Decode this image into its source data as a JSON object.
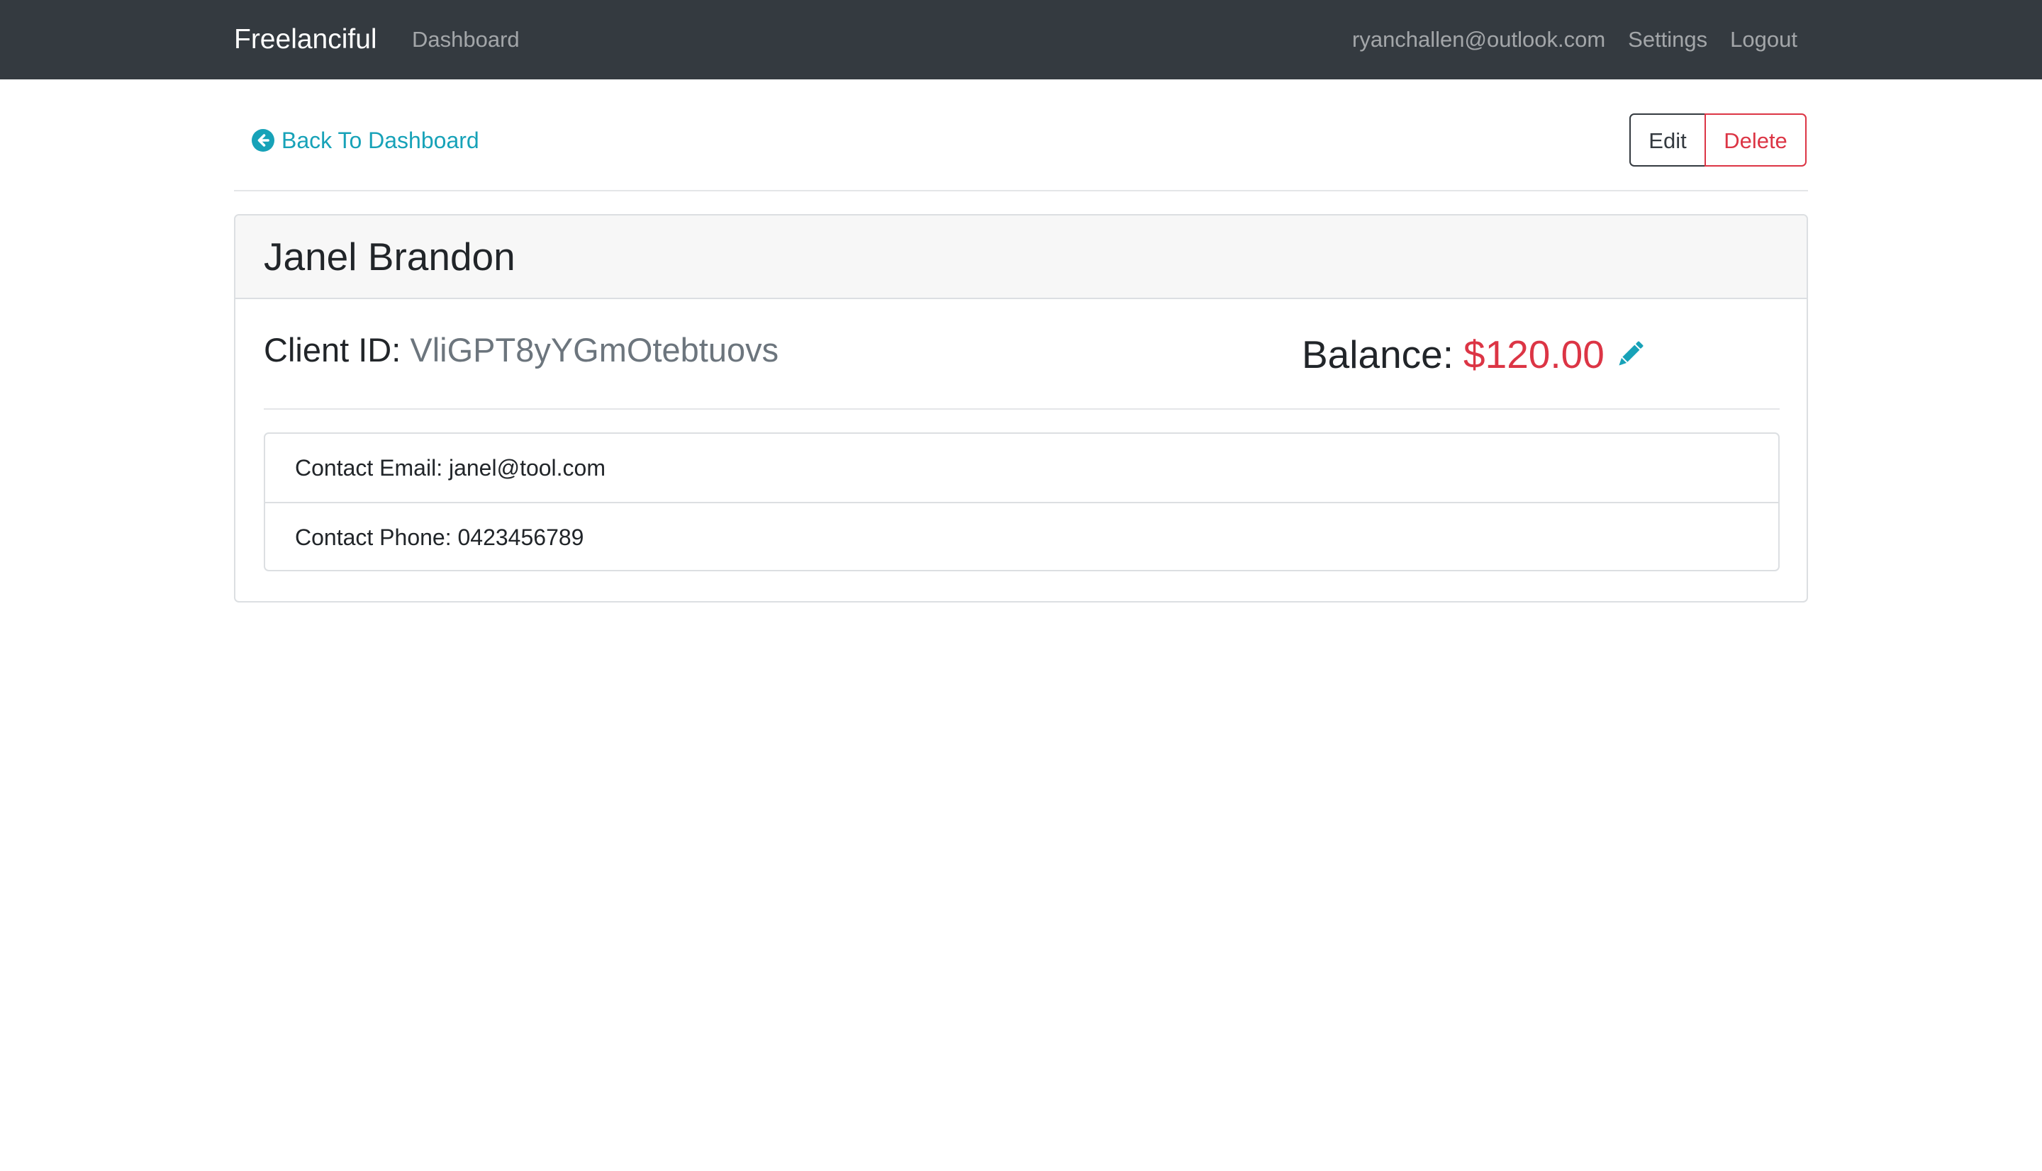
{
  "navbar": {
    "brand": "Freelanciful",
    "dashboard": "Dashboard",
    "user_email": "ryanchallen@outlook.com",
    "settings": "Settings",
    "logout": "Logout"
  },
  "actions": {
    "back_label": "Back To Dashboard",
    "back_icon": "arrow-circle-left-icon",
    "edit_label": "Edit",
    "delete_label": "Delete"
  },
  "client": {
    "name": "Janel Brandon",
    "id_label": "Client ID:",
    "id_value": "VliGPT8yYGmOtebtuovs",
    "balance_label": "Balance:",
    "balance_value": "$120.00",
    "edit_balance_icon": "pencil-icon",
    "contact_email": "Contact Email: janel@tool.com",
    "contact_phone": "Contact Phone: 0423456789"
  },
  "colors": {
    "navbar_bg": "#343a40",
    "accent": "#17a2b8",
    "danger": "#dc3545",
    "muted": "#6c757d"
  }
}
